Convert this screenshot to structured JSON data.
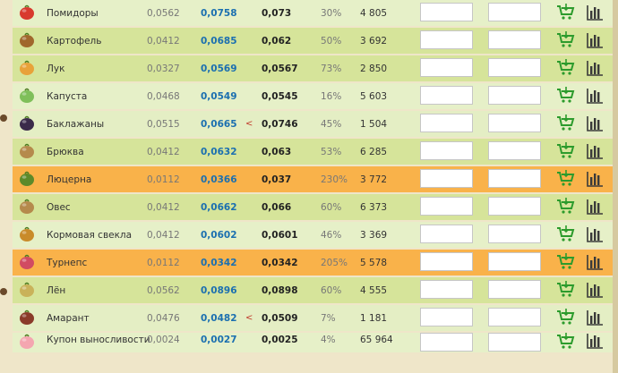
{
  "rows": [
    {
      "name": "Помидоры",
      "v1": "0,0562",
      "v2": "0,0758",
      "lt": "",
      "v3": "0,073",
      "pct": "30%",
      "qty": "4 805",
      "icon": "tomato-icon",
      "color": "#d83a2e",
      "bg": "light"
    },
    {
      "name": "Картофель",
      "v1": "0,0412",
      "v2": "0,0685",
      "lt": "",
      "v3": "0,062",
      "pct": "50%",
      "qty": "3 692",
      "icon": "potato-icon",
      "color": "#a0672c",
      "bg": "alt-b"
    },
    {
      "name": "Лук",
      "v1": "0,0327",
      "v2": "0,0569",
      "lt": "",
      "v3": "0,0567",
      "pct": "73%",
      "qty": "2 850",
      "icon": "onion-icon",
      "color": "#e8a23a",
      "bg": "alt-b"
    },
    {
      "name": "Капуста",
      "v1": "0,0468",
      "v2": "0,0549",
      "lt": "",
      "v3": "0,0545",
      "pct": "16%",
      "qty": "5 603",
      "icon": "cabbage-icon",
      "color": "#7fbf5a",
      "bg": "light"
    },
    {
      "name": "Баклажаны",
      "v1": "0,0515",
      "v2": "0,0665",
      "lt": "<",
      "v3": "0,0746",
      "pct": "45%",
      "qty": "1 504",
      "icon": "eggplant-icon",
      "color": "#3b2b4a",
      "bg": "alt-a"
    },
    {
      "name": "Брюква",
      "v1": "0,0412",
      "v2": "0,0632",
      "lt": "",
      "v3": "0,063",
      "pct": "53%",
      "qty": "6 285",
      "icon": "rutabaga-icon",
      "color": "#b58a4c",
      "bg": "alt-b"
    },
    {
      "name": "Люцерна",
      "v1": "0,0112",
      "v2": "0,0366",
      "lt": "",
      "v3": "0,037",
      "pct": "230%",
      "qty": "3 772",
      "icon": "alfalfa-icon",
      "color": "#5c8a2a",
      "bg": "orange"
    },
    {
      "name": "Овес",
      "v1": "0,0412",
      "v2": "0,0662",
      "lt": "",
      "v3": "0,066",
      "pct": "60%",
      "qty": "6 373",
      "icon": "oats-icon",
      "color": "#b58a4c",
      "bg": "alt-b"
    },
    {
      "name": "Кормовая свекла",
      "v1": "0,0412",
      "v2": "0,0602",
      "lt": "",
      "v3": "0,0601",
      "pct": "46%",
      "qty": "3 369",
      "icon": "beet-icon",
      "color": "#c98b2a",
      "bg": "light"
    },
    {
      "name": "Турнепс",
      "v1": "0,0112",
      "v2": "0,0342",
      "lt": "",
      "v3": "0,0342",
      "pct": "205%",
      "qty": "5 578",
      "icon": "turnip-icon",
      "color": "#d14b62",
      "bg": "orange"
    },
    {
      "name": "Лён",
      "v1": "0,0562",
      "v2": "0,0896",
      "lt": "",
      "v3": "0,0898",
      "pct": "60%",
      "qty": "4 555",
      "icon": "flax-icon",
      "color": "#c9b25a",
      "bg": "alt-b"
    },
    {
      "name": "Амарант",
      "v1": "0,0476",
      "v2": "0,0482",
      "lt": "<",
      "v3": "0,0509",
      "pct": "7%",
      "qty": "1 181",
      "icon": "amaranth-icon",
      "color": "#8a3b2a",
      "bg": "alt-a"
    },
    {
      "name": "Купон выносливости",
      "v1": "0,0024",
      "v2": "0,0027",
      "lt": "",
      "v3": "0,0025",
      "pct": "4%",
      "qty": "65 964",
      "icon": "coupon-icon",
      "color": "#f4a6b0",
      "bg": "light"
    }
  ],
  "colors": {
    "accent_blue": "#1b6fb0",
    "cart_green": "#2c9b2c",
    "orange_row": "#f9b24a"
  }
}
